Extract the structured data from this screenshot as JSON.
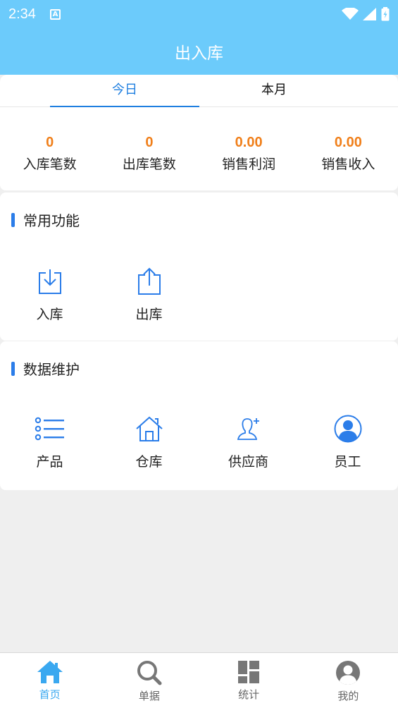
{
  "status_bar": {
    "time": "2:34",
    "notification_icon": "A"
  },
  "header": {
    "title": "出入库"
  },
  "tabs": [
    {
      "label": "今日",
      "active": true
    },
    {
      "label": "本月",
      "active": false
    }
  ],
  "stats": [
    {
      "value": "0",
      "label": "入库笔数"
    },
    {
      "value": "0",
      "label": "出库笔数"
    },
    {
      "value": "0.00",
      "label": "销售利润"
    },
    {
      "value": "0.00",
      "label": "销售收入"
    }
  ],
  "common_functions": {
    "title": "常用功能",
    "items": [
      {
        "label": "入库",
        "icon": "stock-in-icon"
      },
      {
        "label": "出库",
        "icon": "stock-out-icon"
      }
    ]
  },
  "data_maintenance": {
    "title": "数据维护",
    "items": [
      {
        "label": "产品",
        "icon": "list-icon"
      },
      {
        "label": "仓库",
        "icon": "house-icon"
      },
      {
        "label": "供应商",
        "icon": "add-person-icon"
      },
      {
        "label": "员工",
        "icon": "user-circle-icon"
      }
    ]
  },
  "bottom_nav": [
    {
      "label": "首页",
      "icon": "home-icon",
      "active": true
    },
    {
      "label": "单据",
      "icon": "search-icon",
      "active": false
    },
    {
      "label": "统计",
      "icon": "dashboard-icon",
      "active": false
    },
    {
      "label": "我的",
      "icon": "profile-icon",
      "active": false
    }
  ],
  "colors": {
    "header_bg": "#6ccbfb",
    "accent": "#1f7fe0",
    "stat_value": "#f07f1a",
    "nav_active": "#3aa8f0"
  }
}
